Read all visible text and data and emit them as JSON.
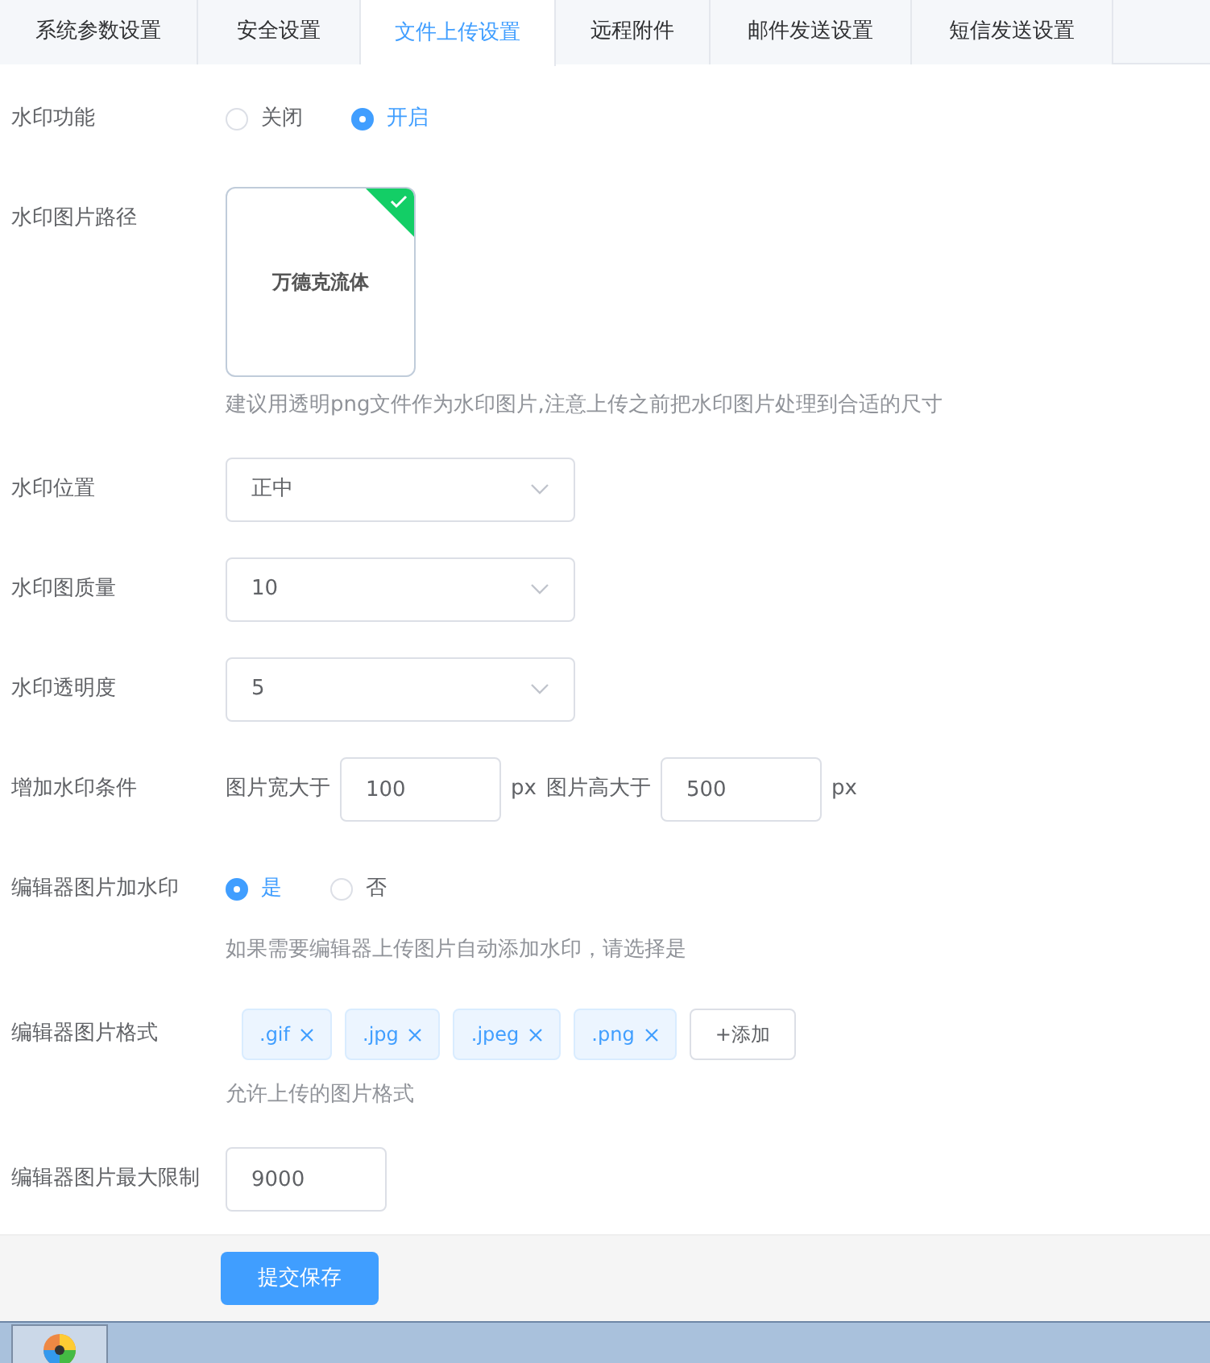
{
  "tabs": [
    {
      "label": "系统参数设置",
      "selected": false
    },
    {
      "label": "安全设置",
      "selected": false
    },
    {
      "label": "文件上传设置",
      "selected": true
    },
    {
      "label": "远程附件",
      "selected": false
    },
    {
      "label": "邮件发送设置",
      "selected": false
    },
    {
      "label": "短信发送设置",
      "selected": false
    }
  ],
  "fields": [
    {
      "kind": "radio",
      "label": "水印功能",
      "options": [
        {
          "label": "关闭",
          "selected": false
        },
        {
          "label": "开启",
          "selected": true
        }
      ]
    },
    {
      "kind": "image",
      "label": "水印图片路径",
      "image_text": "万德克流体",
      "uploaded": true,
      "hint": "建议用透明png文件作为水印图片,注意上传之前把水印图片处理到合适的尺寸"
    },
    {
      "kind": "select",
      "label": "水印位置",
      "value": "正中"
    },
    {
      "kind": "select",
      "label": "水印图质量",
      "value": "10"
    },
    {
      "kind": "select",
      "label": "水印透明度",
      "value": "5"
    },
    {
      "kind": "condition",
      "label": "增加水印条件",
      "parts": [
        {
          "prefix": "图片宽大于",
          "value": "100",
          "unit": "px"
        },
        {
          "prefix": "图片高大于",
          "value": "500",
          "unit": "px"
        }
      ]
    },
    {
      "kind": "radio",
      "label": "编辑器图片加水印",
      "options": [
        {
          "label": "是",
          "selected": true
        },
        {
          "label": "否",
          "selected": false
        }
      ],
      "hint": "如果需要编辑器上传图片自动添加水印，请选择是"
    },
    {
      "kind": "tags",
      "label": "编辑器图片格式",
      "tags": [
        ".gif",
        ".jpg",
        ".jpeg",
        ".png"
      ],
      "add_label": "+添加",
      "hint": "允许上传的图片格式"
    },
    {
      "kind": "input",
      "label": "编辑器图片最大限制",
      "value": "9000"
    }
  ],
  "submit": "提交保存"
}
